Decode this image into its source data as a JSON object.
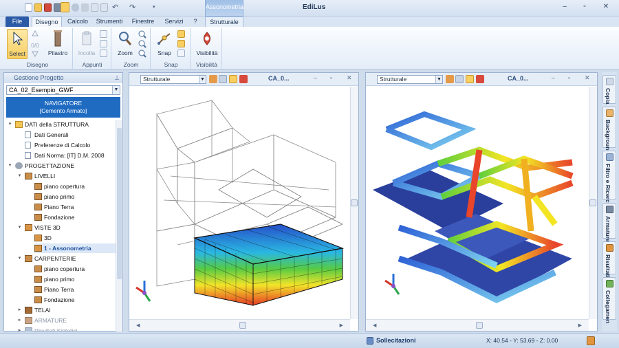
{
  "app": {
    "title": "EdiLus",
    "contextual_group": "Assonometria"
  },
  "tabs": [
    "File",
    "Disegno",
    "Calcolo",
    "Strumenti",
    "Finestre",
    "Servizi",
    "?",
    "Strutturale"
  ],
  "ribbon": {
    "groups": {
      "disegno": "Disegno",
      "appunti": "Appunti",
      "zoom": "Zoom",
      "snap": "Snap",
      "visibilita": "Visibilità"
    },
    "buttons": {
      "select": "Select",
      "pilastro": "Pilastro",
      "incolla": "Incolla",
      "zoom": "Zoom",
      "snap": "Snap",
      "visibilita": "Visibilità",
      "fraction": "0/0"
    }
  },
  "left_panel": {
    "header": "Gestione Progetto",
    "project": "CA_02_Esempio_GWF",
    "navigator_line1": "NAVIGATORE",
    "navigator_line2": "[Cemento Armato]",
    "tree": [
      {
        "label": "DATI della STRUTTURA",
        "toggle": "▾"
      },
      {
        "label": "Dati Generali"
      },
      {
        "label": "Preferenze di Calcolo"
      },
      {
        "label": "Dati Norma: [IT] D.M. 2008"
      },
      {
        "label": "PROGETTAZIONE",
        "toggle": "▾"
      },
      {
        "label": "LIVELLI",
        "toggle": "▾"
      },
      {
        "label": "piano copertura"
      },
      {
        "label": "piano primo"
      },
      {
        "label": "Piano Terra"
      },
      {
        "label": "Fondazione"
      },
      {
        "label": "VISTE 3D",
        "toggle": "▾"
      },
      {
        "label": "3D"
      },
      {
        "label": "1 - Assonometria"
      },
      {
        "label": "CARPENTERIE",
        "toggle": "▾"
      },
      {
        "label": "piano copertura"
      },
      {
        "label": "piano primo"
      },
      {
        "label": "Piano Terra"
      },
      {
        "label": "Fondazione"
      },
      {
        "label": "TELAI",
        "toggle": "▸"
      },
      {
        "label": "ARMATURE",
        "toggle": "▸"
      },
      {
        "label": "Risultati Sintetici",
        "toggle": "▸"
      }
    ]
  },
  "viewports": [
    {
      "view_select": "Strutturale",
      "title": "CA_0..."
    },
    {
      "view_select": "Strutturale",
      "title": "CA_0..."
    }
  ],
  "sidebar": [
    "Copia",
    "Background",
    "Filtro e Ricerca",
    "Armature",
    "Risultati",
    "Collegamen"
  ],
  "status": {
    "mode": "Sollecitazioni",
    "coords": "X: 40.54 - Y: 53.69 - Z: 0.00"
  },
  "colors": {
    "accent": "#2b5aa6",
    "navigator": "#1f6bc2",
    "selection": "#f8cf60"
  }
}
